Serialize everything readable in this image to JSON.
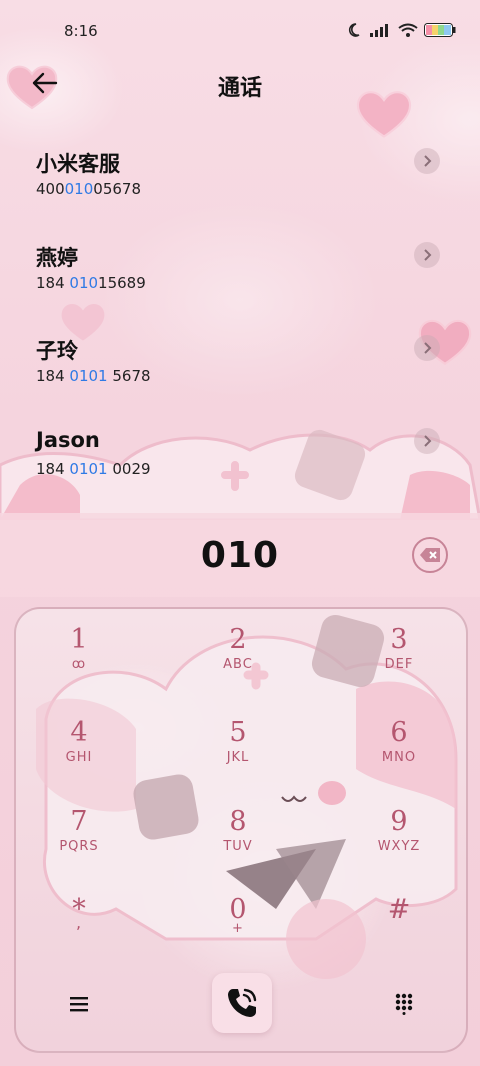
{
  "status_bar": {
    "time": "8:16"
  },
  "header": {
    "title": "通话"
  },
  "contacts": [
    {
      "name": "小米客服",
      "number_pre": "400",
      "number_hl": "010",
      "number_post": "05678"
    },
    {
      "name": "燕婷",
      "number_pre": "184 ",
      "number_hl": "010",
      "number_post": "15689"
    },
    {
      "name": "子玲",
      "number_pre": "184 ",
      "number_hl": "0101",
      "number_post": " 5678"
    },
    {
      "name": "Jason",
      "number_pre": "184 ",
      "number_hl": "0101",
      "number_post": " 0029"
    }
  ],
  "dialer": {
    "input": "010"
  },
  "keys": [
    {
      "digit": "1",
      "letters": "ꝏ"
    },
    {
      "digit": "2",
      "letters": "ABC"
    },
    {
      "digit": "3",
      "letters": "DEF"
    },
    {
      "digit": "4",
      "letters": "GHI"
    },
    {
      "digit": "5",
      "letters": "JKL"
    },
    {
      "digit": "6",
      "letters": "MNO"
    },
    {
      "digit": "7",
      "letters": "PQRS"
    },
    {
      "digit": "8",
      "letters": "TUV"
    },
    {
      "digit": "9",
      "letters": "WXYZ"
    },
    {
      "digit": "*",
      "letters": ","
    },
    {
      "digit": "0",
      "letters": "+"
    },
    {
      "digit": "#",
      "letters": ""
    }
  ],
  "colors": {
    "background": "#f6d6df",
    "highlight": "#2f7ae5",
    "key_text": "#b4566f"
  },
  "icons": {
    "back": "back-arrow-icon",
    "backspace": "backspace-icon",
    "menu": "menu-icon",
    "call": "phone-call-icon",
    "dialpad": "dialpad-icon"
  }
}
